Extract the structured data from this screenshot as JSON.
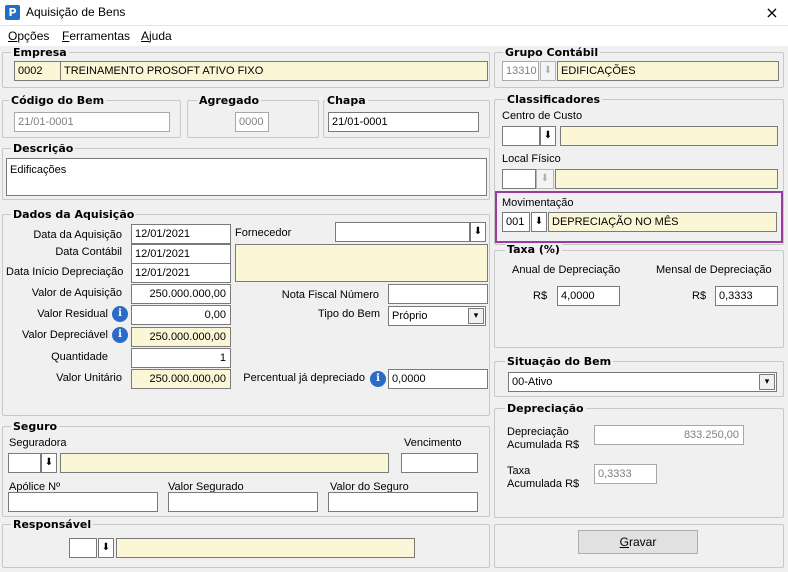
{
  "window": {
    "title": "Aquisição de Bens",
    "app_icon": "P",
    "close_icon": "×"
  },
  "menu": [
    {
      "label": "Opções",
      "accel": "O",
      "rest": "pções"
    },
    {
      "label": "Ferramentas",
      "accel": "F",
      "rest": "erramentas"
    },
    {
      "label": "Ajuda",
      "accel": "A",
      "rest": "juda"
    }
  ],
  "empresa": {
    "legend": "Empresa",
    "code": "0002",
    "name": "TREINAMENTO PROSOFT ATIVO FIXO"
  },
  "grupo": {
    "legend": "Grupo Contábil",
    "code": "13310",
    "name": "EDIFICAÇÕES"
  },
  "codigo": {
    "legend": "Código do Bem",
    "value": "21/01-0001"
  },
  "agregado": {
    "legend": "Agregado",
    "value": "0000"
  },
  "chapa": {
    "legend": "Chapa",
    "value": "21/01-0001"
  },
  "classificadores": {
    "legend": "Classificadores",
    "centro_label": "Centro de Custo",
    "local_label": "Local Físico",
    "mov_label": "Movimentação",
    "mov_code": "001",
    "mov_name": "DEPRECIAÇÃO NO MÊS"
  },
  "descricao": {
    "legend": "Descrição",
    "value": "Edificações"
  },
  "taxa": {
    "legend": "Taxa (%)",
    "anual_label": "Anual de Depreciação",
    "mensal_label": "Mensal de Depreciação",
    "currency": "R$",
    "anual": "4,0000",
    "mensal": "0,3333"
  },
  "aquisicao": {
    "legend": "Dados da Aquisição",
    "data_aquisicao_label": "Data da Aquisição",
    "data_aquisicao": "12/01/2021",
    "data_contabil_label": "Data Contábil",
    "data_contabil": "12/01/2021",
    "data_inicio_label": "Data Início Depreciação",
    "data_inicio": "12/01/2021",
    "valor_aquisicao_label": "Valor de Aquisição",
    "valor_aquisicao": "250.000.000,00",
    "valor_residual_label": "Valor Residual",
    "valor_residual": "0,00",
    "valor_depreciavel_label": "Valor Depreciável",
    "valor_depreciavel": "250.000.000,00",
    "quantidade_label": "Quantidade",
    "quantidade": "1",
    "valor_unitario_label": "Valor Unitário",
    "valor_unitario": "250.000.000,00",
    "fornecedor_label": "Fornecedor",
    "nota_label": "Nota Fiscal Número",
    "tipo_label": "Tipo do Bem",
    "tipo_value": "Próprio",
    "percentual_label": "Percentual já depreciado",
    "percentual": "0,0000"
  },
  "situacao": {
    "legend": "Situação do Bem",
    "value": "00-Ativo"
  },
  "depreciacao": {
    "legend": "Depreciação",
    "acum_label_1": "Depreciação",
    "acum_label_2": "Acumulada R$",
    "acum_value": "833.250,00",
    "taxa_label_1": "Taxa",
    "taxa_label_2": "Acumulada R$",
    "taxa_value": "0,3333"
  },
  "seguro": {
    "legend": "Seguro",
    "seguradora_label": "Seguradora",
    "vencimento_label": "Vencimento",
    "apolice_label": "Apólice Nº",
    "valor_segurado_label": "Valor Segurado",
    "valor_seguro_label": "Valor do Seguro"
  },
  "responsavel": {
    "legend": "Responsável"
  },
  "gravar": {
    "label": "Gravar",
    "accel": "G",
    "rest": "ravar"
  },
  "icons": {
    "download": "⬇",
    "info": "i",
    "dropdown": "▾"
  }
}
